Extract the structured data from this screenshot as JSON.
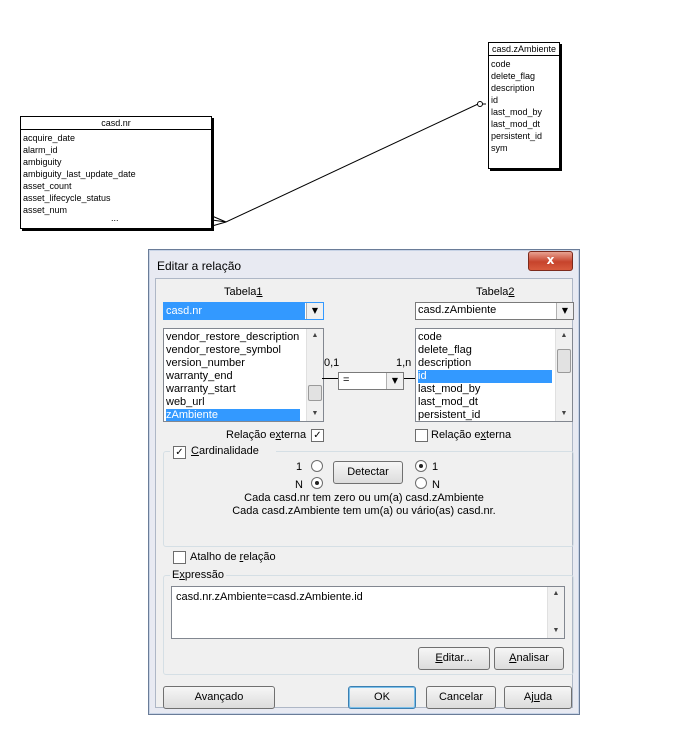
{
  "diagram": {
    "left_table": {
      "title": "casd.nr",
      "fields": [
        "acquire_date",
        "alarm_id",
        "ambiguity",
        "ambiguity_last_update_date",
        "asset_count",
        "asset_lifecycle_status",
        "asset_num"
      ],
      "more": "..."
    },
    "right_table": {
      "title": "casd.zAmbiente",
      "fields": [
        "code",
        "delete_flag",
        "description",
        "id",
        "last_mod_by",
        "last_mod_dt",
        "persistent_id",
        "sym"
      ]
    }
  },
  "dialog": {
    "title": "Editar a relação",
    "close_label": "x",
    "table1": {
      "label": "Tabela1",
      "selected": "casd.nr",
      "items": [
        "vendor_restore_description",
        "vendor_restore_symbol",
        "version_number",
        "warranty_end",
        "warranty_start",
        "web_url",
        "zAmbiente"
      ],
      "selected_item": "zAmbiente"
    },
    "table2": {
      "label": "Tabela2",
      "selected": "casd.zAmbiente",
      "items": [
        "code",
        "delete_flag",
        "description",
        "id",
        "last_mod_by",
        "last_mod_dt",
        "persistent_id"
      ],
      "selected_item": "id"
    },
    "left_cardinality": "0,1",
    "right_cardinality": "1,n",
    "operator": "=",
    "external_relation_label": "Relação externa",
    "cardinality": {
      "label": "Cardinalidade",
      "checked": true,
      "left_one": "1",
      "left_n": "N",
      "right_one": "1",
      "right_n": "N",
      "detect_label": "Detectar",
      "desc1": "Cada casd.nr tem zero ou um(a) casd.zAmbiente",
      "desc2": "Cada casd.zAmbiente tem um(a) ou vário(as) casd.nr."
    },
    "shortcut_label": "Atalho de relação",
    "expression": {
      "label": "Expressão",
      "value": "casd.nr.zAmbiente=casd.zAmbiente.id",
      "edit_label": "Editar...",
      "analyze_label": "Analisar"
    },
    "buttons": {
      "advanced": "Avançado",
      "ok": "OK",
      "cancel": "Cancelar",
      "help": "Ajuda"
    }
  }
}
